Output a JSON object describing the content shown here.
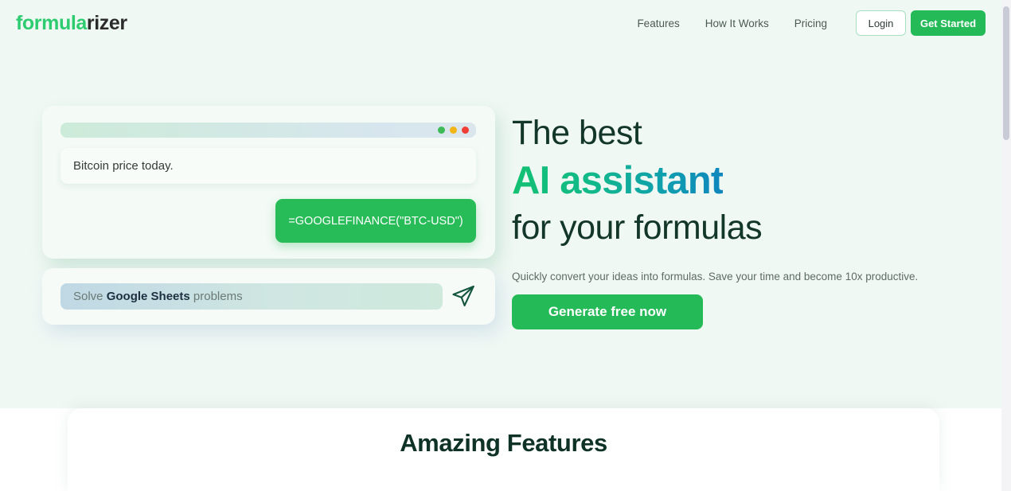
{
  "brand": {
    "logo_accent": "formula",
    "logo_rest": "rizer",
    "accent_color": "#2ecc71",
    "primary_green": "#25ba58",
    "page_background": "#f0f8f4"
  },
  "header": {
    "nav_links": [
      {
        "label": "Features"
      },
      {
        "label": "How It Works"
      },
      {
        "label": "Pricing"
      }
    ],
    "login_label": "Login",
    "get_started_label": "Get Started"
  },
  "chat_mock": {
    "window_dots": [
      {
        "name": "green",
        "color": "#3dbb57"
      },
      {
        "name": "yellow",
        "color": "#f2b418"
      },
      {
        "name": "red",
        "color": "#ef3e35"
      }
    ],
    "user_message": "Bitcoin price today.",
    "bot_message": "=GOOGLEFINANCE(\"BTC-USD\")"
  },
  "search_mock": {
    "prefix": "Solve ",
    "highlight": "Google Sheets",
    "suffix": " problems",
    "send_icon": "send-paper-plane-icon"
  },
  "hero": {
    "line1": "The best",
    "line2": "AI assistant",
    "line3": "for your formulas",
    "subtitle": "Quickly convert your ideas into formulas. Save your time and become 10x productive.",
    "cta_label": "Generate free now",
    "gradient_start": "#13c172",
    "gradient_end": "#0f86bd"
  },
  "features": {
    "title": "Amazing Features"
  }
}
